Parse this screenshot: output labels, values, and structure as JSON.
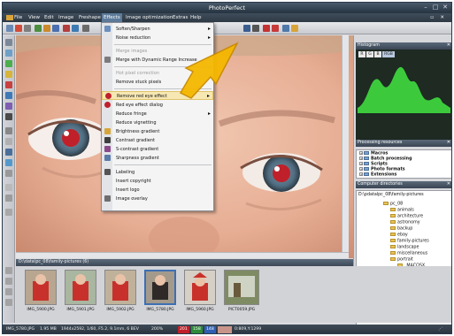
{
  "title": "PhotoPerfect",
  "menubar": [
    "File",
    "View",
    "Edit",
    "Image",
    "Freshape",
    "Effects",
    "Image optimization",
    "Extras",
    "Help"
  ],
  "effects_menu": {
    "items": [
      {
        "label": "Soften/Sharpen",
        "submenu": true,
        "disabled": false
      },
      {
        "label": "Noise reduction",
        "submenu": true,
        "disabled": false
      },
      {
        "label": "Merge images",
        "submenu": false,
        "disabled": true
      },
      {
        "label": "Merge with Dynamic Range Increase",
        "submenu": false,
        "disabled": false
      },
      {
        "label": "Hot pixel correction",
        "submenu": false,
        "disabled": true
      },
      {
        "label": "Remove stuck pixels",
        "submenu": false,
        "disabled": false
      },
      {
        "label": "Remove red eye effect",
        "submenu": true,
        "disabled": false,
        "highlighted": true
      },
      {
        "label": "Red eye effect dialog",
        "submenu": false,
        "disabled": false
      },
      {
        "label": "Reduce fringe",
        "submenu": true,
        "disabled": false
      },
      {
        "label": "Reduce vignetting",
        "submenu": false,
        "disabled": false
      },
      {
        "label": "Brightness gradient",
        "submenu": false,
        "disabled": false
      },
      {
        "label": "Contrast gradient",
        "submenu": false,
        "disabled": false
      },
      {
        "label": "S-contrast gradient",
        "submenu": false,
        "disabled": false
      },
      {
        "label": "Sharpness gradient",
        "submenu": false,
        "disabled": false
      },
      {
        "label": "Labeling",
        "submenu": false,
        "disabled": false
      },
      {
        "label": "Insert copyright",
        "submenu": false,
        "disabled": false
      },
      {
        "label": "Insert logo",
        "submenu": false,
        "disabled": false
      },
      {
        "label": "Image overlay",
        "submenu": false,
        "disabled": false
      }
    ]
  },
  "histogram": {
    "title": "Histogram",
    "channels": [
      "R",
      "G",
      "B",
      "RGB"
    ]
  },
  "processing": {
    "title": "Processing resources",
    "items": [
      "Macros",
      "Batch processing",
      "Scripts",
      "Photo formats",
      "Extensions"
    ]
  },
  "directories": {
    "title": "Computer directories",
    "root": "D:\\pdatalpc_08\\family-pictures",
    "items": [
      "pc_08",
      "animals",
      "architecture",
      "astronomy",
      "backup",
      "ebay",
      "family-pictures",
      "landscape",
      "miscellaneous",
      "portrait",
      "_MACOSX",
      "",
      "",
      ""
    ]
  },
  "path_bar": "D:\\data\\pc_08\\family-pictures (6)",
  "thumbnails": [
    "IMG_5900.JPG",
    "IMG_5901.JPG",
    "IMG_5902.JPG",
    "IMG_5780.JPG",
    "IMG_5960.JPG",
    "PICT0059.JPG"
  ],
  "status": {
    "file": "IMG_5780.JPG",
    "size": "1.95 MB",
    "dims": "1944x2592, 1/60, F5.2, 9.1mm, 6 BEV",
    "zoom": "200%",
    "r": "201",
    "g": "158",
    "b": "148",
    "hex": "",
    "coords": "0:809,Y:1299"
  },
  "colors": {
    "accent": "#f5b700",
    "menu_highlight": "#f6e7b3",
    "titlebar": "#253340"
  }
}
